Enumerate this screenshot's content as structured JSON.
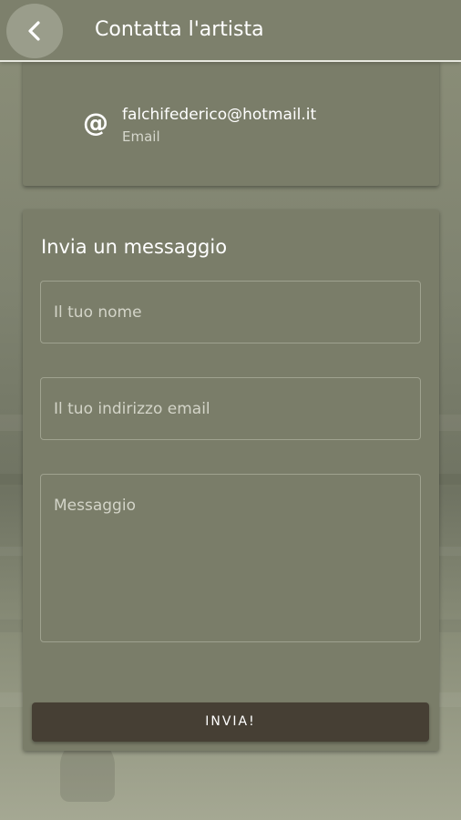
{
  "app_bar": {
    "title": "Contatta l'artista",
    "back_icon": "chevron-left-icon"
  },
  "contact": {
    "icon": "at-icon",
    "icon_glyph": "@",
    "value": "falchifederico@hotmail.it",
    "type": "Email"
  },
  "form": {
    "title": "Invia un messaggio",
    "name_placeholder": "Il tuo nome",
    "email_placeholder": "Il tuo indirizzo email",
    "message_placeholder": "Messaggio",
    "submit_label": "INVIA!"
  },
  "colors": {
    "app_bar": "#7d806c",
    "card": "#7a7d69",
    "button": "#463f34",
    "text": "#ffffff"
  }
}
